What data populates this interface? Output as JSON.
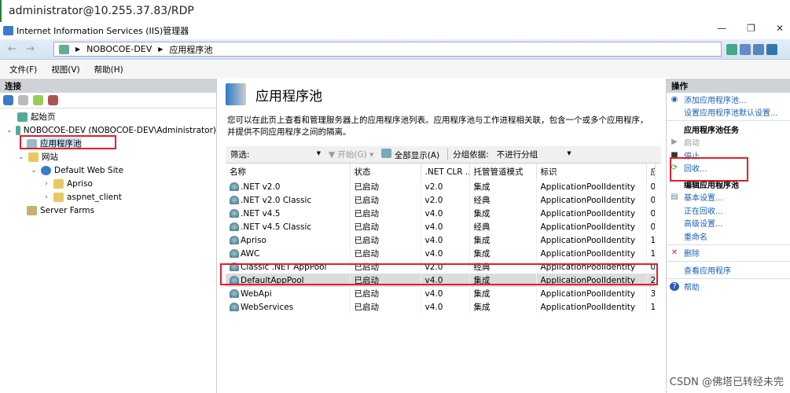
{
  "rdp_title": "administrator@10.255.37.83/RDP",
  "window_title": "Internet Information Services (IIS)管理器",
  "address": {
    "crumbs": [
      "NOBOCOE-DEV",
      "应用程序池"
    ]
  },
  "menu": [
    "文件(F)",
    "视图(V)",
    "帮助(H)"
  ],
  "connections": {
    "title": "连接",
    "tree": {
      "start": "起始页",
      "server": "NOBOCOE-DEV (NOBOCOE-DEV\\Administrator)",
      "pools": "应用程序池",
      "sites": "网站",
      "default_site": "Default Web Site",
      "apriso": "Apriso",
      "aspnet": "aspnet_client",
      "farms": "Server Farms"
    }
  },
  "main": {
    "title": "应用程序池",
    "description": "您可以在此页上查看和管理服务器上的应用程序池列表。应用程序池与工作进程相关联，包含一个或多个应用程序，并提供不同应用程序之间的隔离。",
    "filter": {
      "label": "筛选:",
      "start": "开始(G)",
      "show_all": "全部显示(A)",
      "group_by": "分组依据:",
      "group_value": "不进行分组"
    },
    "columns": [
      "名称",
      "状态",
      ".NET CLR ...",
      "托管管道模式",
      "标识",
      "应"
    ],
    "rows": [
      [
        ".NET v2.0",
        "已启动",
        "v2.0",
        "集成",
        "ApplicationPoolIdentity",
        "0"
      ],
      [
        ".NET v2.0 Classic",
        "已启动",
        "v2.0",
        "经典",
        "ApplicationPoolIdentity",
        "0"
      ],
      [
        ".NET v4.5",
        "已启动",
        "v4.0",
        "集成",
        "ApplicationPoolIdentity",
        "0"
      ],
      [
        ".NET v4.5 Classic",
        "已启动",
        "v4.0",
        "经典",
        "ApplicationPoolIdentity",
        "0"
      ],
      [
        "Apriso",
        "已启动",
        "v4.0",
        "集成",
        "ApplicationPoolIdentity",
        "1"
      ],
      [
        "AWC",
        "已启动",
        "v4.0",
        "集成",
        "ApplicationPoolIdentity",
        "1"
      ],
      [
        "Classic .NET AppPool",
        "已启动",
        "v2.0",
        "经典",
        "ApplicationPoolIdentity",
        "0"
      ],
      [
        "DefaultAppPool",
        "已启动",
        "v4.0",
        "集成",
        "ApplicationPoolIdentity",
        "2"
      ],
      [
        "WebApi",
        "已启动",
        "v4.0",
        "集成",
        "ApplicationPoolIdentity",
        "3"
      ],
      [
        "WebServices",
        "已启动",
        "v4.0",
        "集成",
        "ApplicationPoolIdentity",
        "1"
      ]
    ]
  },
  "actions": {
    "title": "操作",
    "add": "添加应用程序池...",
    "defaults": "设置应用程序池默认设置...",
    "tasks": "应用程序池任务",
    "start": "启动",
    "stop": "停止",
    "recycle": "回收...",
    "edit": "编辑应用程序池",
    "basic": "基本设置...",
    "recycling": "正在回收...",
    "advanced": "高级设置...",
    "rename": "重命名",
    "delete": "删除",
    "view_apps": "查看应用程序",
    "help": "帮助"
  },
  "footer_watermark": "CSDN @佛塔已转经未完"
}
